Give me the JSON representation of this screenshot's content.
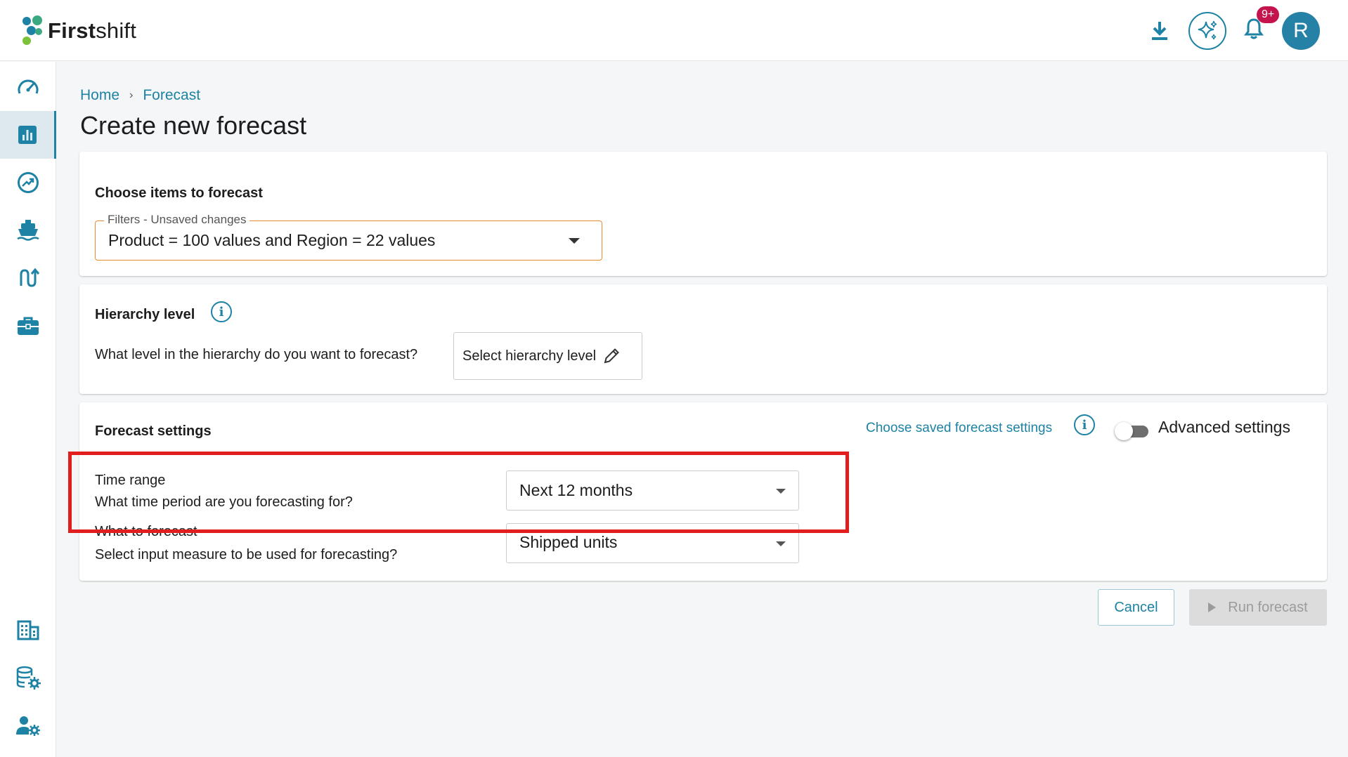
{
  "app": {
    "logo_bold": "First",
    "logo_light": "shift"
  },
  "header": {
    "notification_count": "9+",
    "avatar_initial": "R"
  },
  "breadcrumb": {
    "home": "Home",
    "separator": "›",
    "current": "Forecast"
  },
  "page": {
    "title": "Create new forecast"
  },
  "items_section": {
    "title": "Choose items to forecast",
    "filter_legend": "Filters - Unsaved changes",
    "filter_value": "Product = 100 values and Region = 22 values"
  },
  "hierarchy_section": {
    "title": "Hierarchy level",
    "question": "What level in the hierarchy do you want to forecast?",
    "button_label": "Select hierarchy level"
  },
  "settings_section": {
    "title": "Forecast settings",
    "saved_link": "Choose saved forecast settings",
    "advanced_label": "Advanced settings",
    "advanced_enabled": false,
    "time_range_label": "Time range",
    "time_range_question": "What time period are you forecasting for?",
    "time_range_value": "Next 12 months",
    "what_label": "What to forecast",
    "what_question": "Select input measure to be used for forecasting?",
    "what_value": "Shipped units"
  },
  "actions": {
    "cancel": "Cancel",
    "run": "Run forecast"
  },
  "colors": {
    "accent": "#1e82a5",
    "highlight": "#e21d1d",
    "badge": "#c4134d",
    "filter_border": "#e88a2e"
  }
}
